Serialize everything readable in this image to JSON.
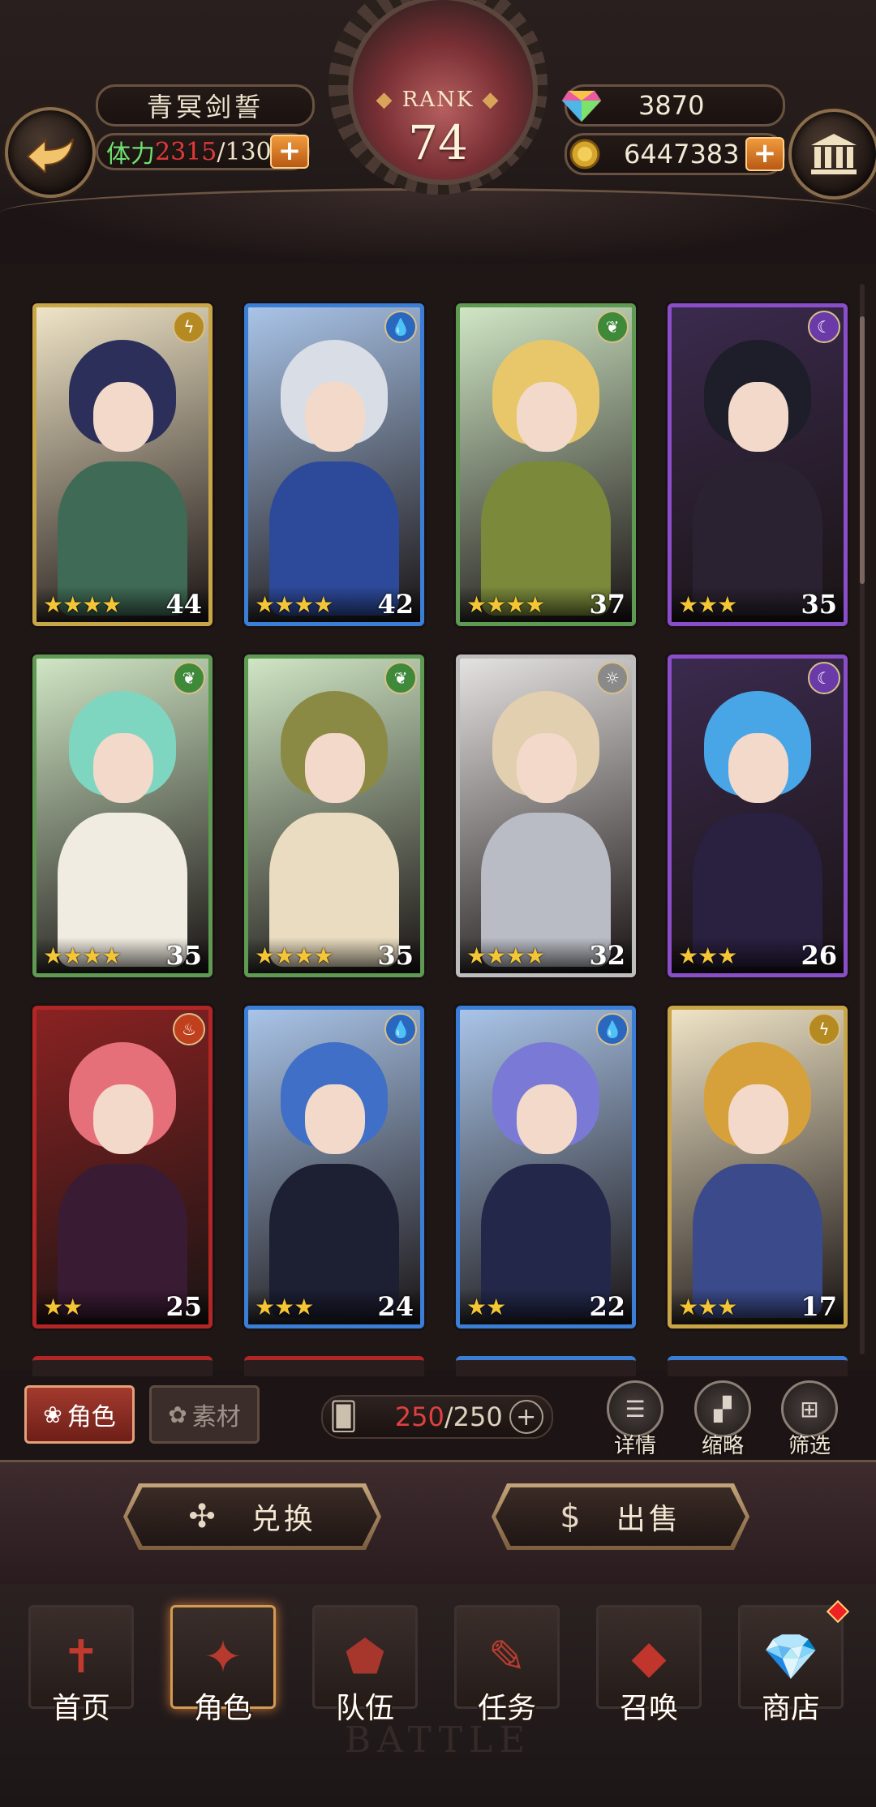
{
  "header": {
    "player_name": "青冥剑誓",
    "stamina_label": "体力",
    "stamina_current": "2315",
    "stamina_max": "/130",
    "rank_label": "RANK",
    "rank_value": "74",
    "gems": "3870",
    "gold": "6447383",
    "plus_symbol": "+"
  },
  "cards": [
    {
      "level": "44",
      "stars": "★★★★",
      "frame": "gold",
      "element": "lightning-icon",
      "colors": {
        "hair": "#2b2f5a",
        "body": "#3f6a55"
      }
    },
    {
      "level": "42",
      "stars": "★★★★",
      "frame": "blue",
      "element": "water-icon",
      "colors": {
        "hair": "#d9dde6",
        "body": "#2d4a9a"
      }
    },
    {
      "level": "37",
      "stars": "★★★★",
      "frame": "green",
      "element": "leaf-icon",
      "colors": {
        "hair": "#e8c76a",
        "body": "#7a8a3a"
      }
    },
    {
      "level": "35",
      "stars": "★★★",
      "frame": "purple",
      "element": "dark-moon-icon",
      "colors": {
        "hair": "#1d1e2a",
        "body": "#2a2230"
      }
    },
    {
      "level": "35",
      "stars": "★★★★",
      "frame": "green",
      "element": "leaf-icon",
      "colors": {
        "hair": "#7fd6c0",
        "body": "#f1ece2"
      }
    },
    {
      "level": "35",
      "stars": "★★★★",
      "frame": "green",
      "element": "leaf-icon",
      "colors": {
        "hair": "#8a8a44",
        "body": "#e9dcc0"
      }
    },
    {
      "level": "32",
      "stars": "★★★★",
      "frame": "white",
      "element": "light-sun-icon",
      "colors": {
        "hair": "#e2cfb0",
        "body": "#b9bcc4"
      }
    },
    {
      "level": "26",
      "stars": "★★★",
      "frame": "purple",
      "element": "dark-moon-icon",
      "colors": {
        "hair": "#49a6e6",
        "body": "#2a2040"
      }
    },
    {
      "level": "25",
      "stars": "★★",
      "frame": "red",
      "element": "fire-icon",
      "colors": {
        "hair": "#e6707a",
        "body": "#3a1b34"
      }
    },
    {
      "level": "24",
      "stars": "★★★",
      "frame": "blue",
      "element": "water-icon",
      "colors": {
        "hair": "#3f6fc6",
        "body": "#1d1f33"
      }
    },
    {
      "level": "22",
      "stars": "★★",
      "frame": "blue",
      "element": "water-icon",
      "colors": {
        "hair": "#7a7ad6",
        "body": "#23284a"
      }
    },
    {
      "level": "17",
      "stars": "★★★",
      "frame": "gold",
      "element": "lightning-icon",
      "colors": {
        "hair": "#d6a13a",
        "body": "#3b4a8a"
      }
    }
  ],
  "filter_bar": {
    "tab_characters": "角色",
    "tab_materials": "素材",
    "capacity_current": "250",
    "capacity_max": "/250",
    "details_label": "详情",
    "thumbnail_label": "缩略",
    "filter_label": "筛选"
  },
  "actions": {
    "exchange_label": "兑换",
    "sell_label": "出售"
  },
  "nav": [
    {
      "label": "首页",
      "icon": "home-banner-icon",
      "glyph": "✝"
    },
    {
      "label": "角色",
      "icon": "character-book-icon",
      "glyph": "✦"
    },
    {
      "label": "队伍",
      "icon": "team-crest-icon",
      "glyph": "⬟"
    },
    {
      "label": "任务",
      "icon": "quest-book-icon",
      "glyph": "✎"
    },
    {
      "label": "召唤",
      "icon": "summon-card-icon",
      "glyph": "◆"
    },
    {
      "label": "商店",
      "icon": "shop-gem-icon",
      "glyph": "💎"
    }
  ],
  "watermark_text": "BATTLE",
  "theme": {
    "accent_red": "#e04040",
    "frame_gold": "#c8a648",
    "plus_orange": "#e07a22"
  }
}
